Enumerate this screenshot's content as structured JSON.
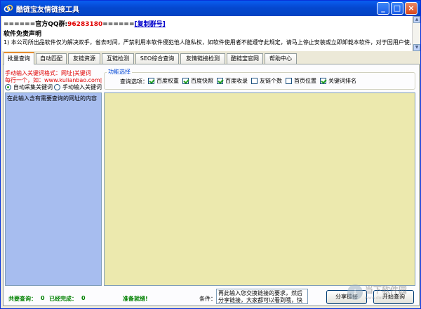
{
  "window": {
    "title": "酷链宝友情链接工具",
    "minimize_glyph": "_",
    "maximize_glyph": "□",
    "close_glyph": "×"
  },
  "notice": {
    "qq_prefix": "======官方QQ群:",
    "qq_number": "96283180",
    "qq_suffix": "======",
    "copy_group_link": "[复制群号]",
    "disclaimer_title": "软件免责声明",
    "disclaimer_body": "1) 本公司所出品软件仅为解决双手，省去时间，严禁利用本软件侵犯他人隐私权，如软件使用者不能遵守此规定，请马上停止安装或立即卸载本软件，对于因用户使用本软件而"
  },
  "tabs": [
    {
      "label": "批量查询",
      "active": true
    },
    {
      "label": "自动匹配",
      "active": false
    },
    {
      "label": "友链资源",
      "active": false
    },
    {
      "label": "互链检测",
      "active": false
    },
    {
      "label": "SEO综合查询",
      "active": false
    },
    {
      "label": "友情链接检测",
      "active": false
    },
    {
      "label": "酷链宝官网",
      "active": false
    },
    {
      "label": "帮助中心",
      "active": false
    }
  ],
  "left": {
    "hint_line1": "手动输入关键词格式：网址|关键词",
    "hint_line2": "每行一个，如：www.kulianbao.com|酷链宝",
    "radio_auto": "自动采集关键词",
    "radio_manual": "手动输入关键词",
    "radio_selected": "auto",
    "url_placeholder": "在此输入含有需要查询的网址的内容"
  },
  "options": {
    "legend": "功能选择",
    "label": "查询选项：",
    "items": [
      {
        "label": "百度权重",
        "checked": true
      },
      {
        "label": "百度快照",
        "checked": true
      },
      {
        "label": "百度收录",
        "checked": true
      },
      {
        "label": "友链个数",
        "checked": false
      },
      {
        "label": "首页位置",
        "checked": false
      },
      {
        "label": "关键词排名",
        "checked": true
      }
    ]
  },
  "status": {
    "total_label": "共要查询：",
    "total_value": "0",
    "done_label": "已经完成：",
    "done_value": "0",
    "ready": "准备就绪!"
  },
  "condition": {
    "label": "条件：",
    "text": "再此输入您交换链接的要求，然后分享链接，大家都可以看到哦，快来试试吧!"
  },
  "buttons": {
    "share": "分享链接",
    "start": "开始查询"
  },
  "watermark": {
    "text": "当下软件园",
    "sub": "www.downxia.com"
  }
}
